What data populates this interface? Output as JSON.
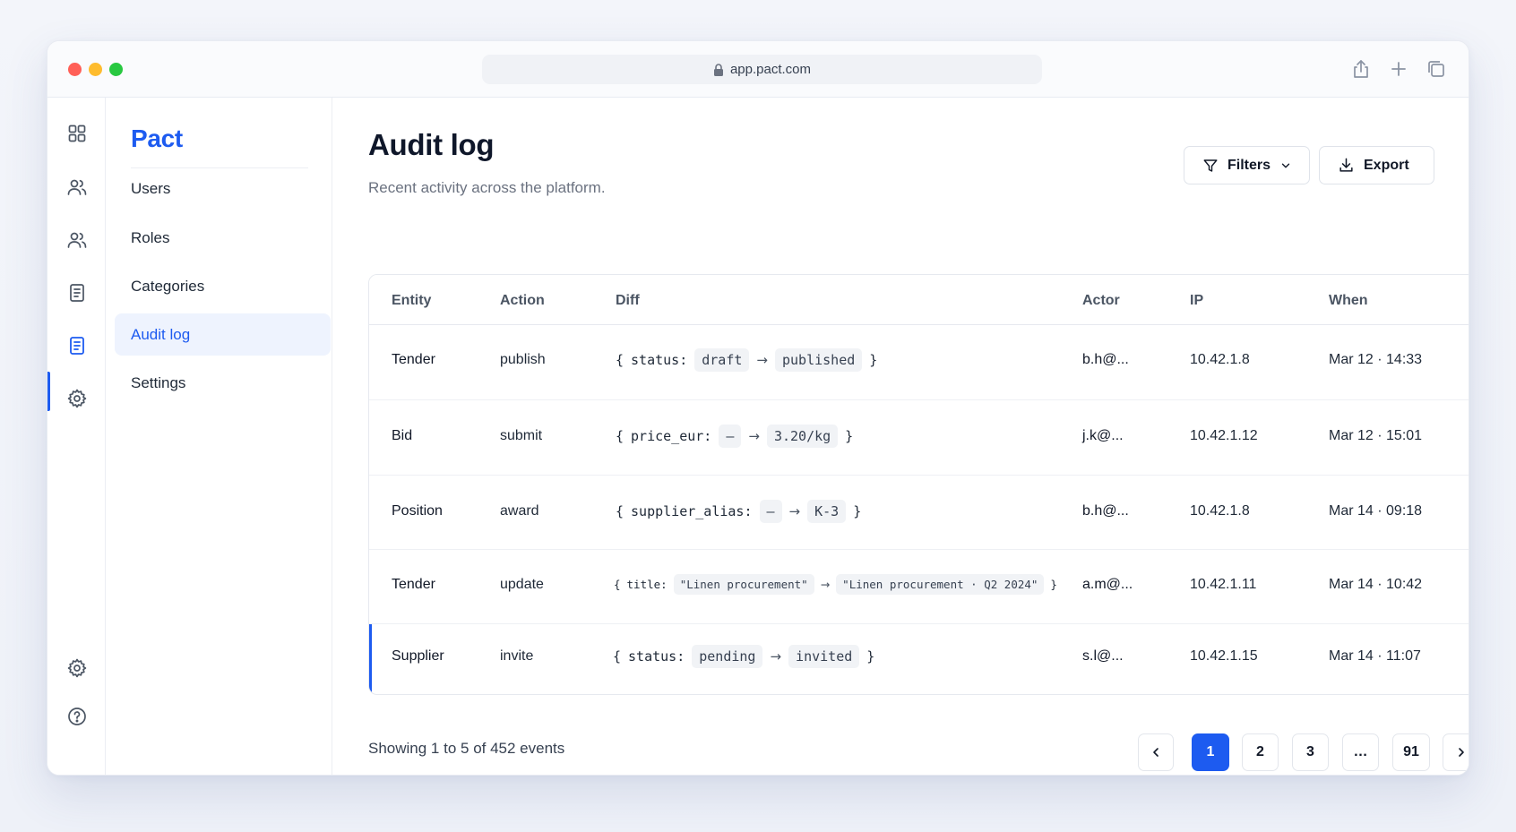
{
  "browser": {
    "url": "app.pact.com"
  },
  "sidebar": {
    "brand": "Pact",
    "items": [
      {
        "label": "Users",
        "icon": "users-icon"
      },
      {
        "label": "Roles",
        "icon": "users-icon"
      },
      {
        "label": "Categories",
        "icon": "document-icon"
      },
      {
        "label": "Audit log",
        "icon": "document-icon",
        "active": true
      },
      {
        "label": "Settings",
        "icon": "gear-icon"
      }
    ]
  },
  "header": {
    "title": "Audit log",
    "subtitle": "Recent activity across the platform.",
    "filters_label": "Filters",
    "export_label": "Export"
  },
  "table": {
    "columns": [
      "Entity",
      "Action",
      "Diff",
      "Actor",
      "IP",
      "When"
    ],
    "rows": [
      {
        "entity": "Tender",
        "action": "publish",
        "diff": {
          "key": "status:",
          "from": "draft",
          "to": "published"
        },
        "actor": "b.h@...",
        "ip": "10.42.1.8",
        "when": "Mar 12 · 14:33"
      },
      {
        "entity": "Bid",
        "action": "submit",
        "diff": {
          "key": "price_eur:",
          "from": "—",
          "to": "3.20/kg"
        },
        "actor": "j.k@...",
        "ip": "10.42.1.12",
        "when": "Mar 12 · 15:01"
      },
      {
        "entity": "Position",
        "action": "award",
        "diff": {
          "key": "supplier_alias:",
          "from": "—",
          "to": "K-3"
        },
        "actor": "b.h@...",
        "ip": "10.42.1.8",
        "when": "Mar 14 · 09:18"
      },
      {
        "entity": "Tender",
        "action": "update",
        "diff": {
          "key": "title:",
          "from": "\"Linen procurement\"",
          "to": "\"Linen procurement · Q2 2024\""
        },
        "actor": "a.m@...",
        "ip": "10.42.1.11",
        "when": "Mar 14 · 10:42"
      },
      {
        "entity": "Supplier",
        "action": "invite",
        "diff": {
          "key": "status:",
          "from": "pending",
          "to": "invited"
        },
        "actor": "s.l@...",
        "ip": "10.42.1.15",
        "when": "Mar 14 · 11:07"
      }
    ]
  },
  "footer": {
    "summary": "Showing 1 to 5 of 452 events",
    "pages": [
      "1",
      "2",
      "3",
      "…",
      "91"
    ],
    "current_page": "1"
  },
  "syntax": {
    "open_brace": "{",
    "close_brace": "}",
    "arrow": "→"
  },
  "colors": {
    "accent": "#1d5bf0"
  }
}
